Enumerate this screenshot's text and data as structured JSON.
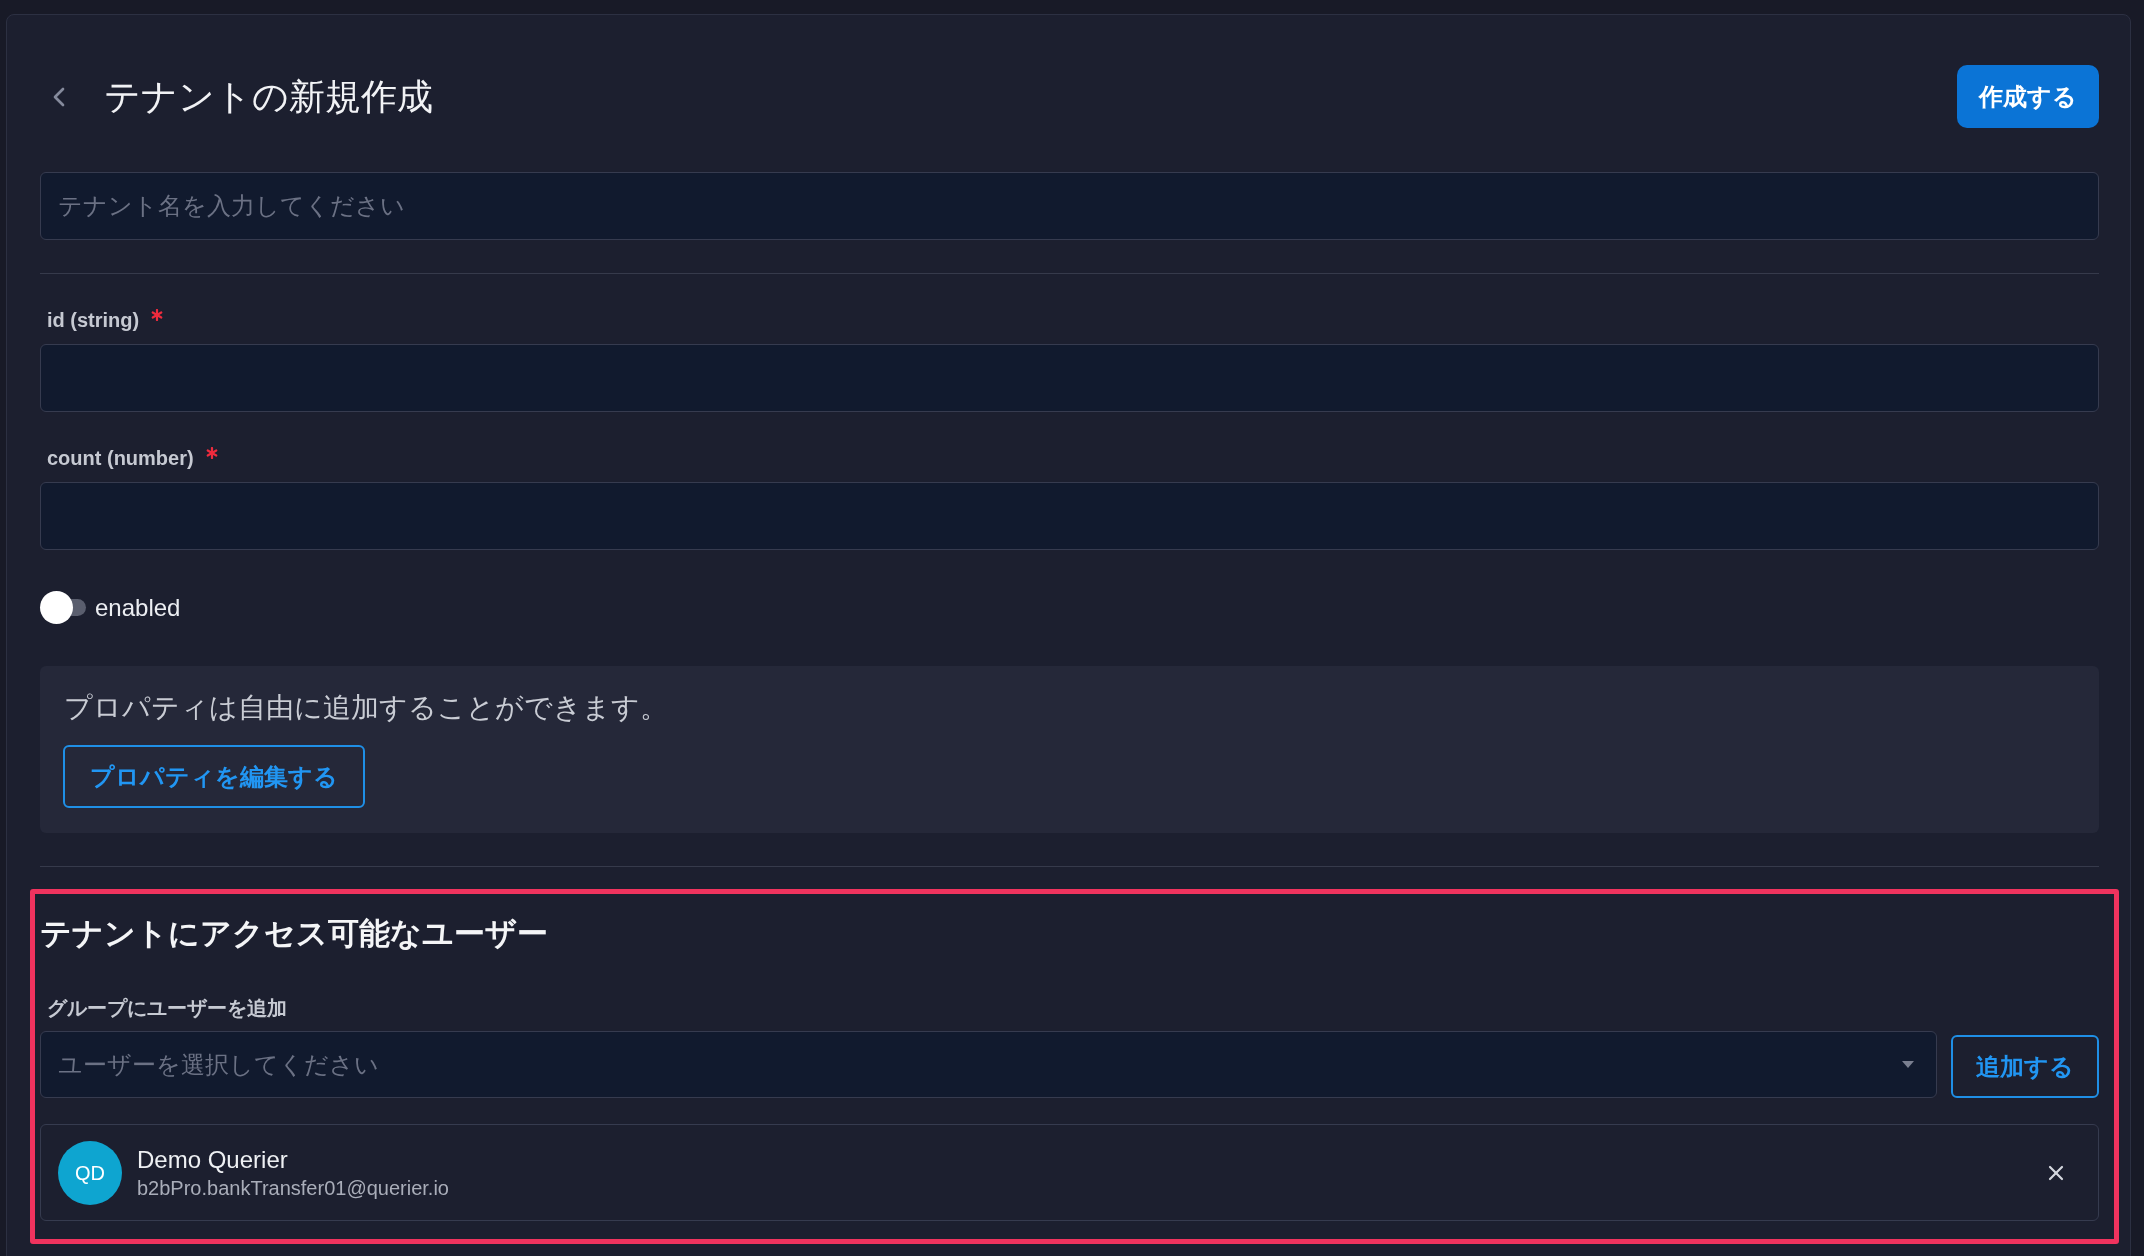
{
  "header": {
    "title": "テナントの新規作成",
    "create_button": "作成する"
  },
  "tenant_name": {
    "placeholder": "テナント名を入力してください"
  },
  "fields": [
    {
      "label": "id (string)",
      "required": true
    },
    {
      "label": "count (number)",
      "required": true
    }
  ],
  "toggle": {
    "label": "enabled",
    "on": false
  },
  "properties": {
    "text": "プロパティは自由に追加することができます。",
    "button": "プロパティを編集する"
  },
  "users_section": {
    "highlighted": true,
    "title": "テナントにアクセス可能なユーザー",
    "add_label": "グループにユーザーを追加",
    "select": {
      "placeholder": "ユーザーを選択してください"
    },
    "add_button": "追加する",
    "users": [
      {
        "initials": "QD",
        "name": "Demo Querier",
        "email": "b2bPro.bankTransfer01@querier.io"
      }
    ]
  }
}
